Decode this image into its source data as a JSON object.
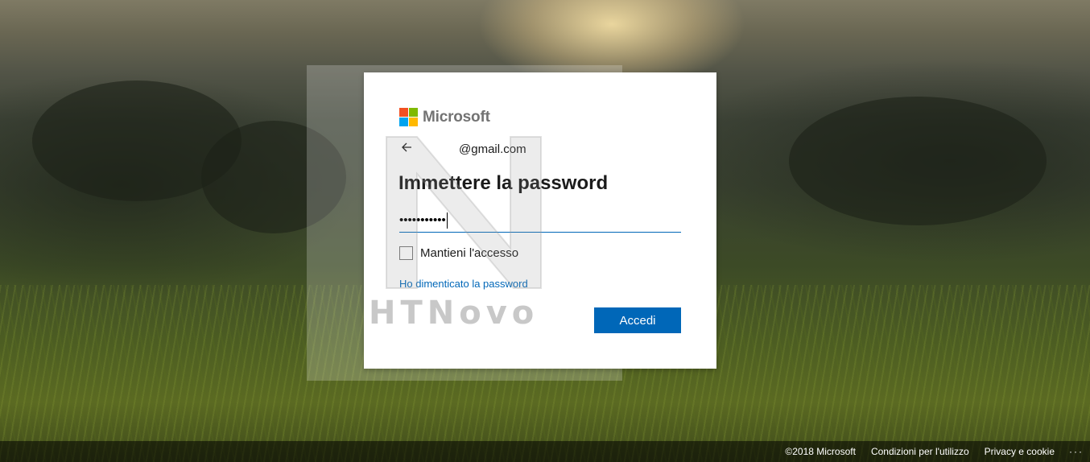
{
  "brand": {
    "name": "Microsoft",
    "logo_colors": [
      "#f25022",
      "#7fba00",
      "#00a4ef",
      "#ffb900"
    ],
    "accent": "#0067b8"
  },
  "identity": {
    "back_icon": "arrow-left-icon",
    "email": "@gmail.com"
  },
  "form": {
    "title": "Immettere la password",
    "password_mask": "•••••••••••",
    "keep_signed_in_label": "Mantieni l'accesso",
    "keep_signed_in_checked": false,
    "forgot_link": "Ho dimenticato la password",
    "signin_button": "Accedi"
  },
  "watermark": {
    "text": "HTNovo"
  },
  "footer": {
    "copyright": "©2018 Microsoft",
    "terms": "Condizioni per l'utilizzo",
    "privacy": "Privacy e cookie",
    "more": "···"
  }
}
